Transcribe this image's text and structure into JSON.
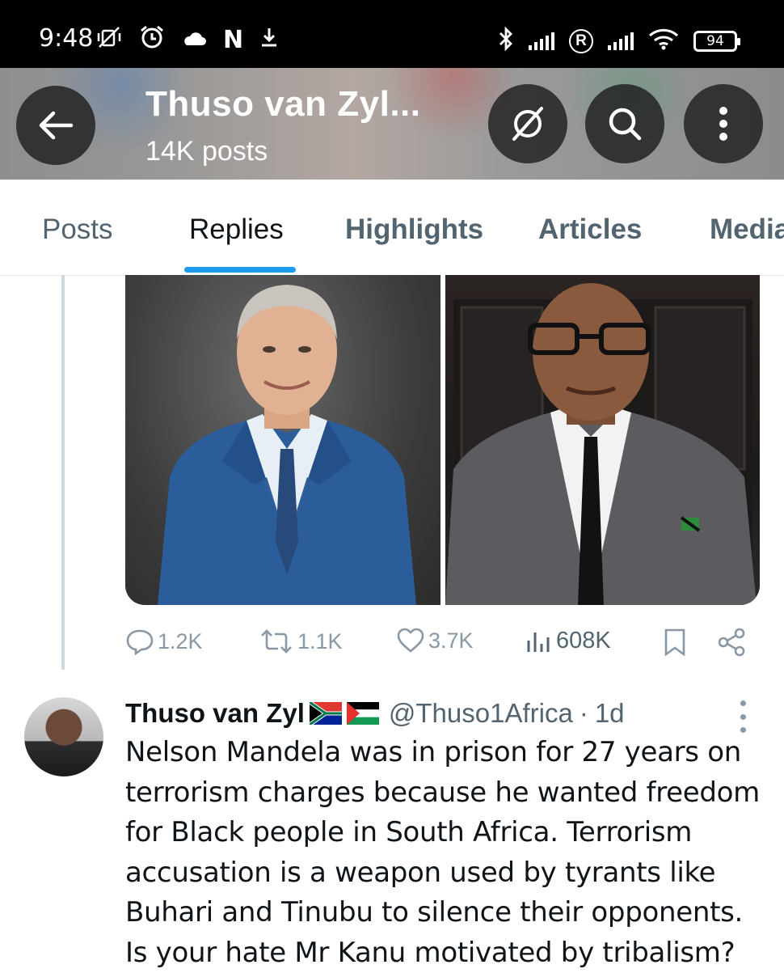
{
  "status_bar": {
    "time": "9:48",
    "left_icons": [
      "vibrate-off-icon",
      "alarm-icon",
      "cloud-icon",
      "netflix-n-icon",
      "download-icon"
    ],
    "left_glyph_n": "N",
    "right_icons": [
      "bluetooth-icon",
      "signal-icon",
      "roaming-r-icon",
      "signal-icon",
      "wifi-icon",
      "battery-icon"
    ],
    "roaming_label": "R",
    "battery": "94"
  },
  "header": {
    "title": "Thuso van Zyl...",
    "posts_count": "14K posts",
    "accent": "#1d9bf0"
  },
  "tabs": [
    {
      "label": "Posts",
      "active": false
    },
    {
      "label": "Replies",
      "active": true
    },
    {
      "label": "Highlights",
      "active": false
    },
    {
      "label": "Articles",
      "active": false
    },
    {
      "label": "Media",
      "active": false
    }
  ],
  "tweet1": {
    "photos": [
      "man-in-blue-suit-photo",
      "man-with-glasses-photo"
    ],
    "reply_count": "1.2K",
    "retweet_count": "1.1K",
    "like_count": "3.7K",
    "view_count": "608K"
  },
  "tweet2": {
    "author_name": "Thuso van Zyl",
    "flags": [
      "south-africa-flag",
      "palestine-flag"
    ],
    "handle": "@Thuso1Africa",
    "separator": "·",
    "time": "1d",
    "text": "Nelson Mandela was in prison for 27 years on terrorism charges because he wanted freedom for Black people in South Africa. Terrorism accusation is a weapon used by tyrants like Buhari and Tinubu to silence their opponents. Is your hate Mr Kanu motivated by tribalism?"
  }
}
